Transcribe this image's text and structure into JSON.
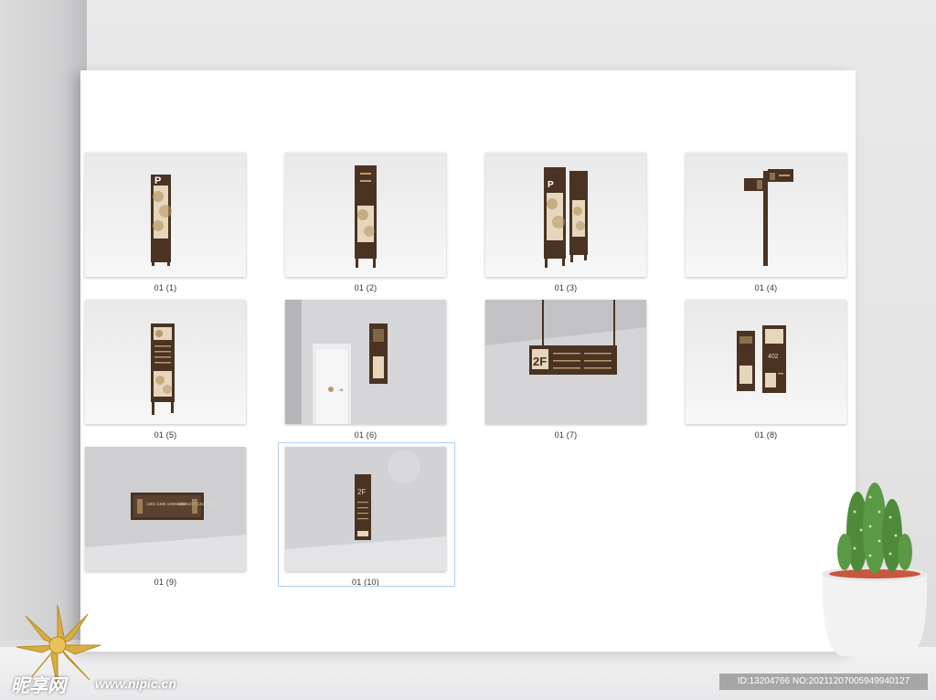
{
  "gallery": {
    "items": [
      {
        "caption": "01 (1)"
      },
      {
        "caption": "01 (2)"
      },
      {
        "caption": "01 (3)"
      },
      {
        "caption": "01 (4)"
      },
      {
        "caption": "01 (5)"
      },
      {
        "caption": "01 (6)"
      },
      {
        "caption": "01 (7)"
      },
      {
        "caption": "01 (8)"
      },
      {
        "caption": "01 (9)"
      },
      {
        "caption": "01 (10)"
      }
    ]
  },
  "signs": {
    "parking_letter": "P",
    "floor_label": "2F",
    "room_number": "402",
    "plaque_text_left": "1301-1305 1306-1310",
    "plaque_text_right": "1311-1317 1318-1325"
  },
  "watermark": {
    "logo_text": "昵享网",
    "site_url": "www.nipic.cn",
    "image_id": "ID:13204766 NO:20211207005949940127"
  },
  "colors": {
    "sign_brown": "#4a3322",
    "sign_accent": "#b89a6a",
    "canvas_bg": "#ffffff"
  }
}
